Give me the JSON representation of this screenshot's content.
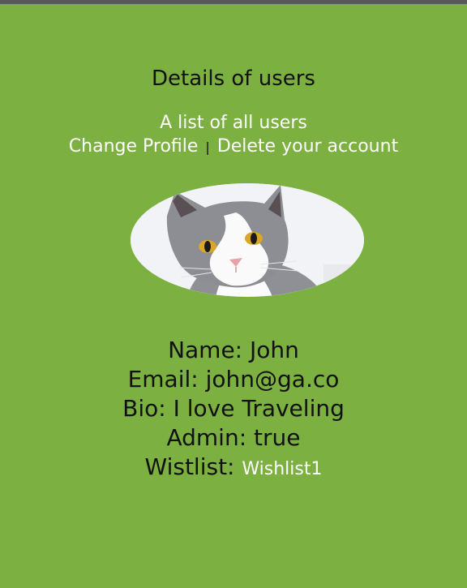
{
  "page": {
    "title": "Details of users"
  },
  "nav": {
    "list_users": "A list of all users",
    "change_profile": "Change Profile",
    "separator": "|",
    "delete_account": "Delete your account"
  },
  "avatar": {
    "alt": "cat avatar"
  },
  "user": {
    "name_label": "Name: ",
    "name": "John",
    "email_label": "Email: ",
    "email": "john@ga.co",
    "bio_label": "Bio: ",
    "bio": "I love Traveling",
    "admin_label": "Admin: ",
    "admin": "true",
    "wishlist_label": "Wistlist: ",
    "wishlist": "Wishlist1"
  },
  "colors": {
    "background": "#7cb041",
    "link": "#ffffff",
    "text": "#111111",
    "topbar": "#595959"
  }
}
